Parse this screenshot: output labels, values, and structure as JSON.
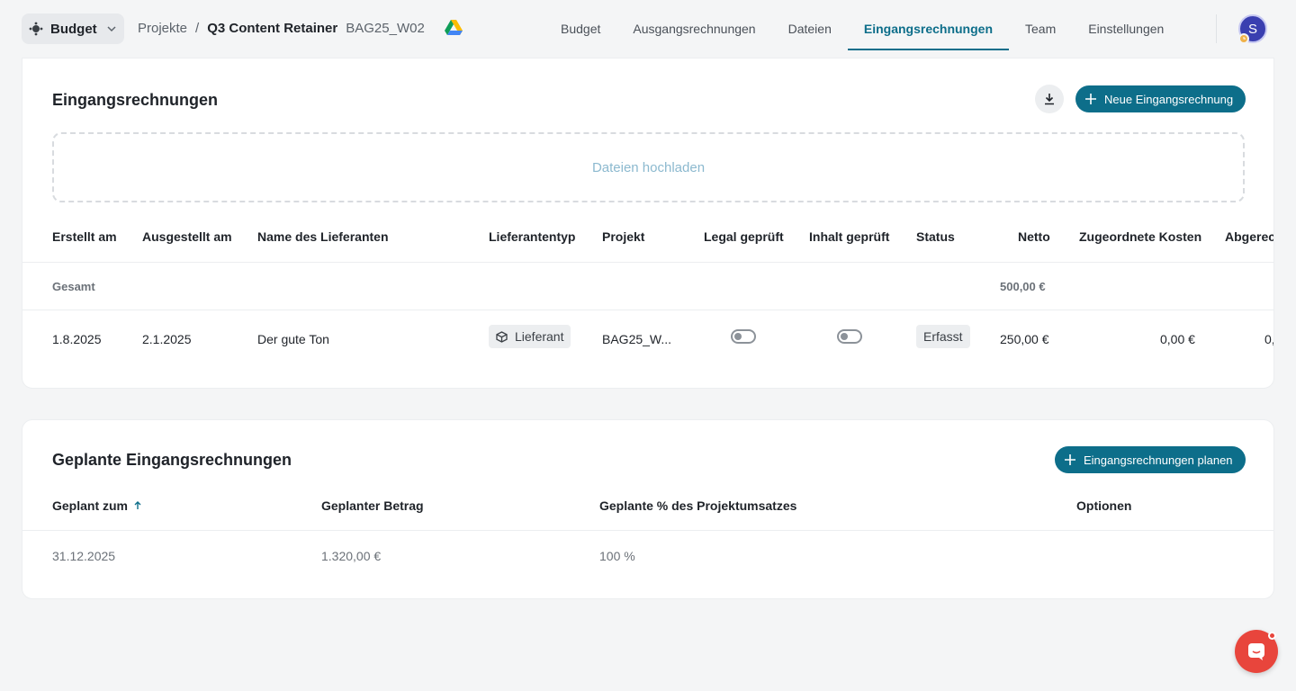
{
  "topbar": {
    "app_label": "Budget",
    "breadcrumb": {
      "projects": "Projekte",
      "separator": "/",
      "title": "Q3 Content Retainer",
      "code": "BAG25_W02"
    },
    "tabs": [
      {
        "label": "Budget",
        "active": false
      },
      {
        "label": "Ausgangsrechnungen",
        "active": false
      },
      {
        "label": "Dateien",
        "active": false
      },
      {
        "label": "Eingangsrechnungen",
        "active": true
      },
      {
        "label": "Team",
        "active": false
      },
      {
        "label": "Einstellungen",
        "active": false
      }
    ],
    "avatar_initial": "S"
  },
  "invoices": {
    "title": "Eingangsrechnungen",
    "new_button": "Neue Eingangsrechnung",
    "dropzone": "Dateien hochladen",
    "columns": [
      "Erstellt am",
      "Ausgestellt am",
      "Name des Lieferanten",
      "Lieferantentyp",
      "Projekt",
      "Legal geprüft",
      "Inhalt geprüft",
      "Status",
      "Netto",
      "Zugeordnete Kosten",
      "Abgerec"
    ],
    "total_label": "Gesamt",
    "total_net": "500,00 €",
    "rows": [
      {
        "created": "1.8.2025",
        "issued": "2.1.2025",
        "supplier": "Der gute Ton",
        "supplier_type": "Lieferant",
        "project": "BAG25_W...",
        "legal_checked": false,
        "content_checked": false,
        "status": "Erfasst",
        "net": "250,00 €",
        "assigned_costs": "0,00 €",
        "billed": "0,"
      }
    ]
  },
  "planned": {
    "title": "Geplante Eingangsrechnungen",
    "plan_button": "Eingangsrechnungen planen",
    "columns": [
      "Geplant zum",
      "Geplanter Betrag",
      "Geplante % des Projektumsatzes",
      "Optionen"
    ],
    "rows": [
      {
        "date": "31.12.2025",
        "amount": "1.320,00 €",
        "percent": "100 %"
      }
    ]
  },
  "colors": {
    "accent": "#0d6e8a",
    "chat": "#e8453c"
  }
}
